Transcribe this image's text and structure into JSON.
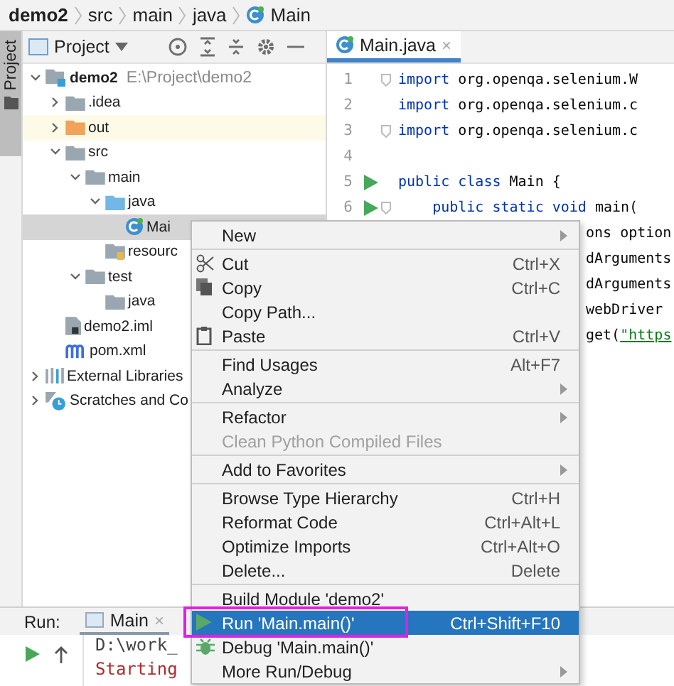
{
  "breadcrumb": [
    {
      "label": "demo2",
      "kind": "module"
    },
    {
      "label": "src",
      "kind": "folder"
    },
    {
      "label": "main",
      "kind": "folder"
    },
    {
      "label": "java",
      "kind": "folder"
    },
    {
      "label": "Main",
      "kind": "class"
    }
  ],
  "side_tab": {
    "label": "Project",
    "selected": true
  },
  "project_panel": {
    "title": "Project"
  },
  "tree": [
    {
      "label": "demo2",
      "path": "E:\\Project\\demo2",
      "kind": "module",
      "expanded": true,
      "selected": false,
      "children": [
        {
          "label": ".idea",
          "kind": "folder",
          "expanded": false,
          "selected": false
        },
        {
          "label": "out",
          "kind": "excluded",
          "expanded": false,
          "selected": false
        },
        {
          "label": "src",
          "kind": "folder",
          "expanded": true,
          "selected": false,
          "children": [
            {
              "label": "main",
              "kind": "folder",
              "expanded": true,
              "selected": false,
              "children": [
                {
                  "label": "java",
                  "kind": "source",
                  "expanded": true,
                  "selected": false,
                  "children": [
                    {
                      "label": "Mai",
                      "kind": "class",
                      "selected": true
                    }
                  ]
                },
                {
                  "label": "resourc",
                  "kind": "resources",
                  "selected": false
                }
              ]
            },
            {
              "label": "test",
              "kind": "folder",
              "expanded": true,
              "selected": false,
              "children": [
                {
                  "label": "java",
                  "kind": "folder",
                  "selected": false
                }
              ]
            }
          ]
        },
        {
          "label": "demo2.iml",
          "kind": "iml",
          "selected": false
        },
        {
          "label": "pom.xml",
          "kind": "maven",
          "selected": false
        }
      ]
    },
    {
      "label": "External Libraries",
      "kind": "libraries",
      "expanded": false,
      "selected": false
    },
    {
      "label": "Scratches and Co",
      "kind": "scratches",
      "expanded": false,
      "selected": false
    }
  ],
  "editor": {
    "tab": {
      "label": "Main.java",
      "close": "×",
      "selected": true
    },
    "lines": [
      {
        "number": "1",
        "fold": true,
        "runnable": false,
        "covered": false,
        "tokens": [
          {
            "text": "import",
            "kind": "kw"
          },
          {
            "text": " org.openqa.selenium.W",
            "kind": "plain"
          }
        ]
      },
      {
        "number": "2",
        "fold": false,
        "runnable": false,
        "covered": false,
        "tokens": [
          {
            "text": "import",
            "kind": "kw"
          },
          {
            "text": " org.openqa.selenium.c",
            "kind": "plain"
          }
        ]
      },
      {
        "number": "3",
        "fold": true,
        "runnable": false,
        "covered": false,
        "tokens": [
          {
            "text": "import",
            "kind": "kw"
          },
          {
            "text": " org.openqa.selenium.c",
            "kind": "plain"
          }
        ]
      },
      {
        "number": "4",
        "fold": false,
        "runnable": false,
        "covered": false
      },
      {
        "number": "5",
        "fold": false,
        "runnable": true,
        "covered": false,
        "tokens": [
          {
            "text": "public class",
            "kind": "kw"
          },
          {
            "text": " Main {",
            "kind": "plain"
          }
        ]
      },
      {
        "number": "6",
        "fold": true,
        "runnable": true,
        "covered": false,
        "tokens": [
          {
            "text": "    public static void",
            "kind": "kw"
          },
          {
            "text": " main(",
            "kind": "plain"
          }
        ]
      },
      {
        "covered": true,
        "tokens": [
          {
            "text": "ons option",
            "kind": "plain"
          }
        ]
      },
      {
        "covered": true,
        "tokens": [
          {
            "text": "dArguments",
            "kind": "plain"
          }
        ]
      },
      {
        "covered": true,
        "tokens": [
          {
            "text": "dArguments",
            "kind": "plain"
          }
        ]
      },
      {
        "covered": true,
        "tokens": [
          {
            "text": "webDriver",
            "kind": "plain"
          }
        ]
      },
      {
        "covered": true,
        "tokens": [
          {
            "text": "get(",
            "kind": "plain"
          },
          {
            "text": "\"https",
            "kind": "str"
          }
        ]
      }
    ]
  },
  "run_panel": {
    "label": "Run:",
    "tab": {
      "label": "Main",
      "close": "×",
      "selected": true
    },
    "console": [
      {
        "text": "D:\\work_",
        "kind": "command"
      },
      {
        "text": "Starting",
        "kind": "error"
      }
    ]
  },
  "context_menu": [
    {
      "kind": "plain",
      "label": "New",
      "submenu": true,
      "selected": false,
      "disabled": false
    },
    {
      "kind": "separator"
    },
    {
      "kind": "cut",
      "label": "Cut",
      "shortcut": "Ctrl+X",
      "selected": false,
      "disabled": false
    },
    {
      "kind": "copy",
      "label": "Copy",
      "shortcut": "Ctrl+C",
      "selected": false,
      "disabled": false
    },
    {
      "kind": "plain",
      "label": "Copy Path...",
      "selected": false,
      "disabled": false
    },
    {
      "kind": "paste",
      "label": "Paste",
      "shortcut": "Ctrl+V",
      "selected": false,
      "disabled": false
    },
    {
      "kind": "separator"
    },
    {
      "kind": "plain",
      "label": "Find Usages",
      "shortcut": "Alt+F7",
      "selected": false,
      "disabled": false
    },
    {
      "kind": "plain",
      "label": "Analyze",
      "submenu": true,
      "selected": false,
      "disabled": false
    },
    {
      "kind": "separator"
    },
    {
      "kind": "plain",
      "label": "Refactor",
      "submenu": true,
      "selected": false,
      "disabled": false
    },
    {
      "kind": "plain",
      "label": "Clean Python Compiled Files",
      "selected": false,
      "disabled": true
    },
    {
      "kind": "separator"
    },
    {
      "kind": "plain",
      "label": "Add to Favorites",
      "submenu": true,
      "selected": false,
      "disabled": false
    },
    {
      "kind": "separator"
    },
    {
      "kind": "plain",
      "label": "Browse Type Hierarchy",
      "shortcut": "Ctrl+H",
      "selected": false,
      "disabled": false
    },
    {
      "kind": "plain",
      "label": "Reformat Code",
      "shortcut": "Ctrl+Alt+L",
      "selected": false,
      "disabled": false
    },
    {
      "kind": "plain",
      "label": "Optimize Imports",
      "shortcut": "Ctrl+Alt+O",
      "selected": false,
      "disabled": false
    },
    {
      "kind": "plain",
      "label": "Delete...",
      "shortcut": "Delete",
      "selected": false,
      "disabled": false
    },
    {
      "kind": "separator"
    },
    {
      "kind": "plain",
      "label": "Build Module 'demo2'",
      "selected": false,
      "disabled": false
    },
    {
      "kind": "run",
      "label": "Run 'Main.main()'",
      "shortcut": "Ctrl+Shift+F10",
      "selected": true,
      "disabled": false,
      "outlined": true
    },
    {
      "kind": "debug",
      "label": "Debug 'Main.main()'",
      "selected": false,
      "disabled": false
    },
    {
      "kind": "plain",
      "label": "More Run/Debug",
      "submenu": true,
      "selected": false,
      "disabled": false
    }
  ]
}
